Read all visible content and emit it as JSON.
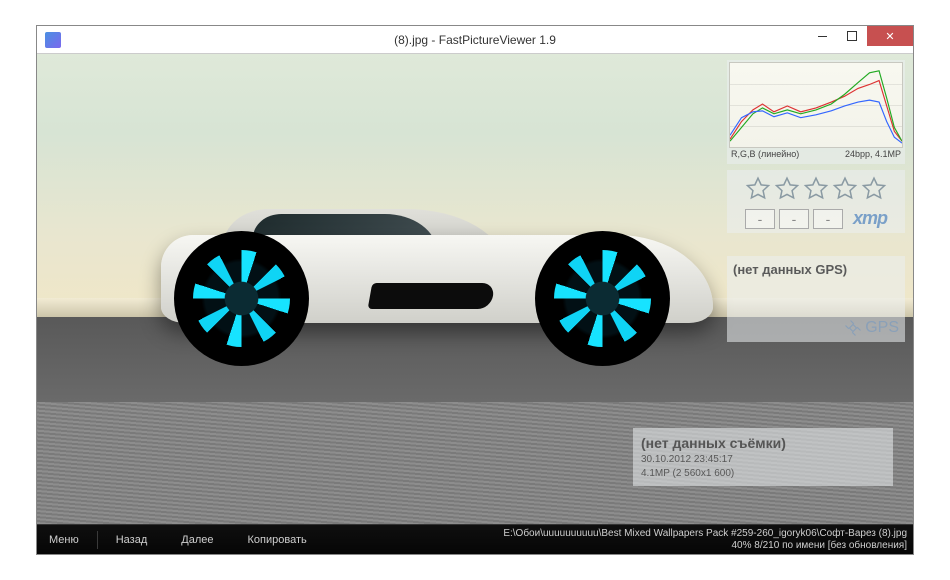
{
  "window": {
    "title": "(8).jpg - FastPictureViewer 1.9",
    "controls": {
      "min": "minimize",
      "max": "maximize",
      "close": "close"
    }
  },
  "histogram": {
    "mode_label": "R,G,B (линейно)",
    "info_label": "24bpp, 4.1MP"
  },
  "rating": {
    "stars_count": 5,
    "box1": "-",
    "box2": "-",
    "box3": "-",
    "xmp_label": "xmp"
  },
  "gps": {
    "title": "(нет данных GPS)",
    "badge": "GPS"
  },
  "exif": {
    "title": "(нет данных съёмки)",
    "date": "30.10.2012 23:45:17",
    "size": "4.1MP (2 560x1 600)"
  },
  "bottombar": {
    "menu": "Меню",
    "back": "Назад",
    "next": "Далее",
    "copy": "Копировать",
    "path_line": "E:\\Обои\\uuuuuuuuuu\\Best Mixed Wallpapers Pack #259-260_igoryk06\\Софт-Варез (8).jpg",
    "status_line": "40%  8/210  по имени  [без обновления]"
  }
}
